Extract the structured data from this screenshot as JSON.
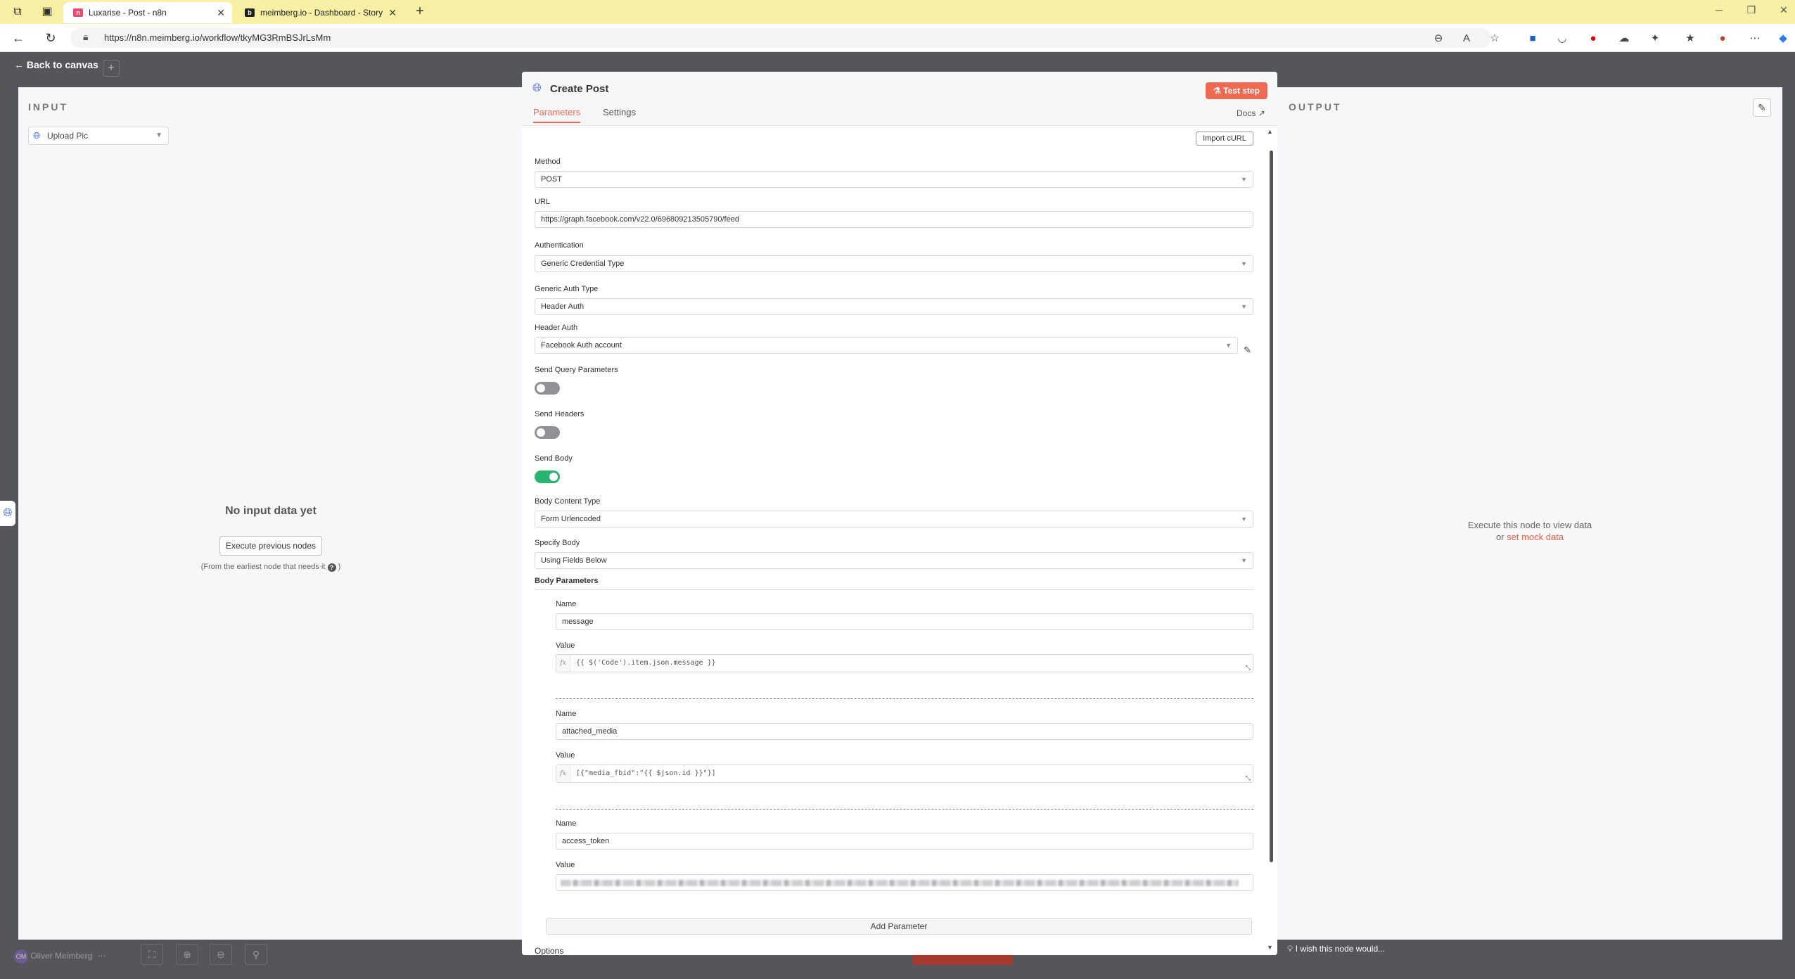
{
  "browser": {
    "tabs": [
      {
        "title": "Luxarise - Post - n8n",
        "active": true
      },
      {
        "title": "meimberg.io - Dashboard - Story",
        "active": false
      }
    ],
    "address": "https://n8n.meimberg.io/workflow/tkyMG3RmBSJrLsMm"
  },
  "app": {
    "back_label": "Back to canvas",
    "input": {
      "title": "INPUT",
      "node_select": "Upload Pic",
      "empty_title": "No input data yet",
      "exec_button": "Execute previous nodes",
      "note_prefix": "(From the earliest node that needs it",
      "note_suffix": ")"
    },
    "output": {
      "title": "OUTPUT",
      "msg_line1": "Execute this node to view data",
      "msg_or": "or",
      "msg_link": "set mock data"
    },
    "user_name": "Oliver Meimberg",
    "wish_text": "I wish this node would..."
  },
  "modal": {
    "title": "Create Post",
    "test_button": "Test step",
    "tabs": {
      "parameters": "Parameters",
      "settings": "Settings"
    },
    "docs": "Docs",
    "import_curl": "Import cURL",
    "method": {
      "label": "Method",
      "value": "POST"
    },
    "url": {
      "label": "URL",
      "value": "https://graph.facebook.com/v22.0/696809213505790/feed"
    },
    "authentication": {
      "label": "Authentication",
      "value": "Generic Credential Type"
    },
    "generic_auth_type": {
      "label": "Generic Auth Type",
      "value": "Header Auth"
    },
    "header_auth": {
      "label": "Header Auth",
      "value": "Facebook Auth account"
    },
    "send_query": {
      "label": "Send Query Parameters",
      "on": false
    },
    "send_headers": {
      "label": "Send Headers",
      "on": false
    },
    "send_body": {
      "label": "Send Body",
      "on": true
    },
    "body_content_type": {
      "label": "Body Content Type",
      "value": "Form Urlencoded"
    },
    "specify_body": {
      "label": "Specify Body",
      "value": "Using Fields Below"
    },
    "body_parameters_label": "Body Parameters",
    "body_parameters": [
      {
        "name_label": "Name",
        "name": "message",
        "value_label": "Value",
        "value": "{{ $('Code').item.json.message }}"
      },
      {
        "name_label": "Name",
        "name": "attached_media",
        "value_label": "Value",
        "value": "[{\"media_fbid\":\"{{ $json.id }}\"}]"
      },
      {
        "name_label": "Name",
        "name": "access_token",
        "value_label": "Value",
        "value": ""
      }
    ],
    "add_parameter": "Add Parameter",
    "options_label": "Options"
  }
}
